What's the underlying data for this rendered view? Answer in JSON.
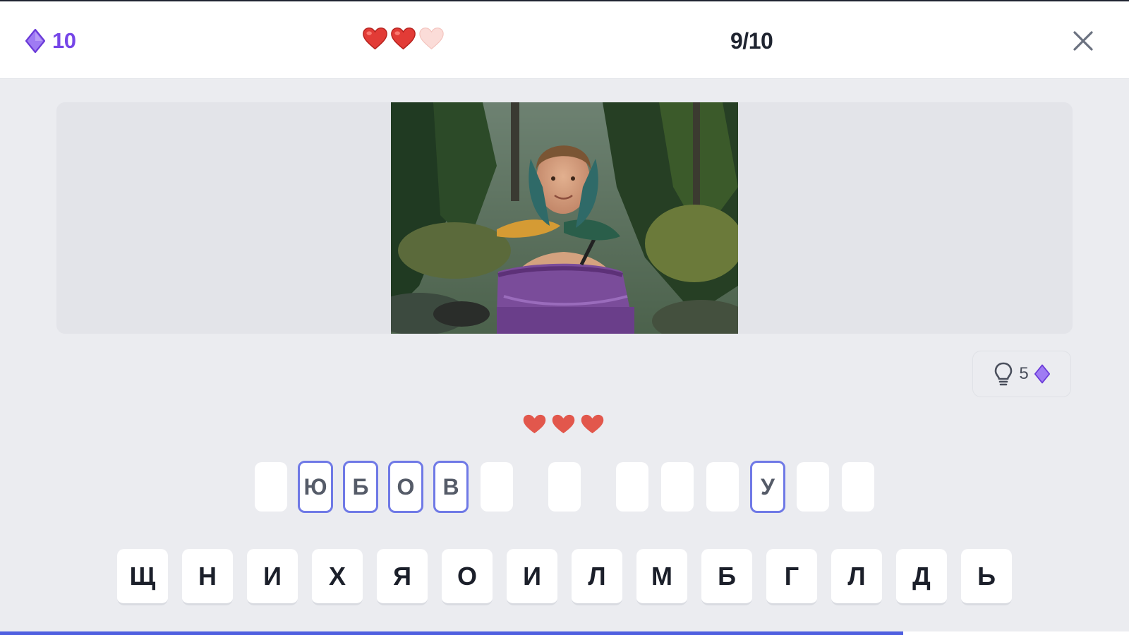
{
  "header": {
    "gems": "10",
    "lives": {
      "total": 3,
      "remaining": 2
    },
    "progress": "9/10",
    "icons": {
      "gem": "gem-icon",
      "life": "heart-icon",
      "close": "close-icon"
    }
  },
  "colors": {
    "accent": "#7646e8",
    "slot_border": "#6f79e6",
    "heart_full": "#e23b36",
    "heart_empty": "#fbdcd8",
    "attempt_heart": "#e2574c",
    "progress": "#4f5fe0"
  },
  "hint": {
    "count": "5",
    "icons": [
      "lightbulb-icon",
      "gem-icon"
    ]
  },
  "attempts": {
    "count": 3,
    "icon": "heart-icon"
  },
  "answer": {
    "slots": [
      {
        "letter": ""
      },
      {
        "letter": "Ю"
      },
      {
        "letter": "Б"
      },
      {
        "letter": "О"
      },
      {
        "letter": "В"
      },
      {
        "letter": ""
      },
      {
        "letter": ""
      },
      {
        "letter": ""
      },
      {
        "letter": ""
      },
      {
        "letter": ""
      },
      {
        "letter": "У"
      },
      {
        "letter": ""
      },
      {
        "letter": ""
      }
    ]
  },
  "keyboard": {
    "keys": [
      "Щ",
      "Н",
      "И",
      "Х",
      "Я",
      "О",
      "И",
      "Л",
      "М",
      "Б",
      "Г",
      "Л",
      "Д",
      "Ь"
    ]
  },
  "level_progress": 0.8
}
